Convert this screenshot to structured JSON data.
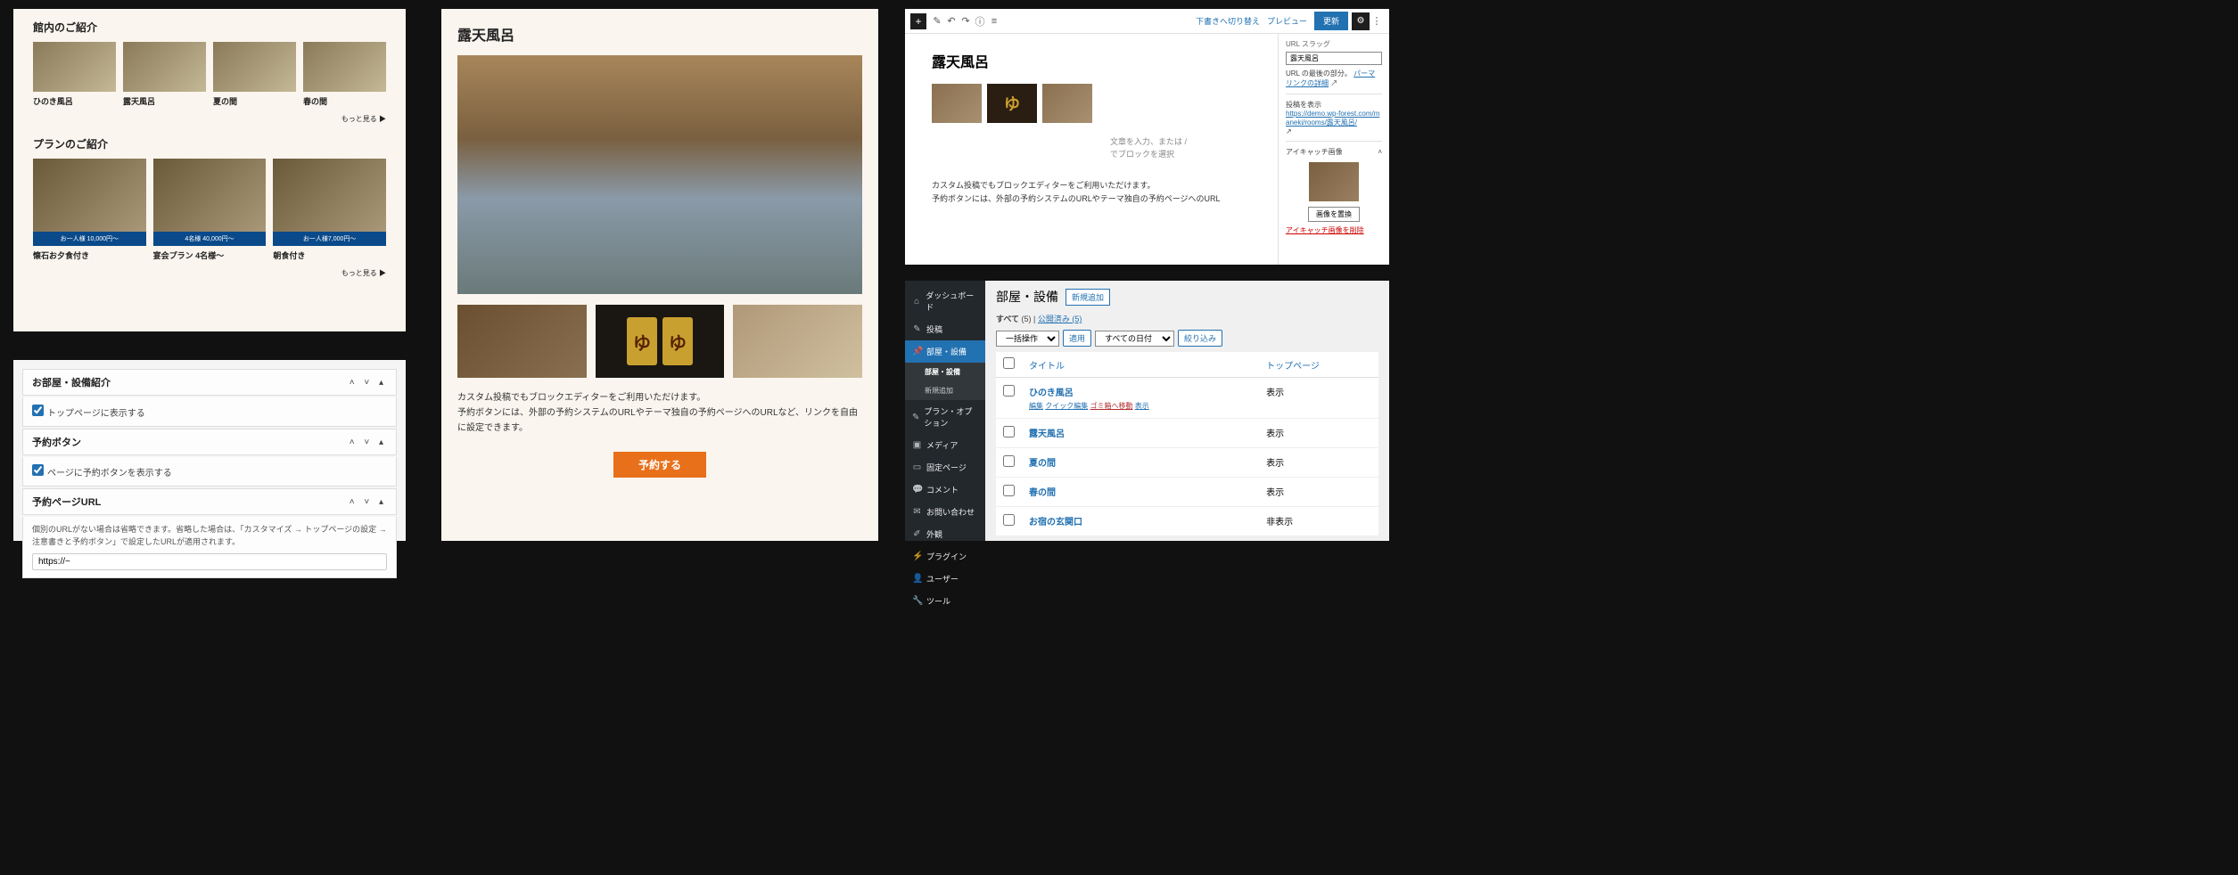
{
  "panel1": {
    "section1_title": "館内のご紹介",
    "rooms": [
      {
        "label": "ひのき風呂"
      },
      {
        "label": "露天風呂"
      },
      {
        "label": "夏の間"
      },
      {
        "label": "春の間"
      }
    ],
    "more": "もっと見る ▶",
    "section2_title": "プランのご紹介",
    "plans": [
      {
        "band": "お一人様 10,000円〜",
        "label": "懐石お夕食付き"
      },
      {
        "band": "4名様 40,000円〜",
        "label": "宴会プラン 4名様〜"
      },
      {
        "band": "お一人様7,000円〜",
        "label": "朝食付き"
      }
    ]
  },
  "panel2": {
    "h1": "お部屋・設備紹介",
    "chk1": "トップページに表示する",
    "h2": "予約ボタン",
    "chk2": "ページに予約ボタンを表示する",
    "h3": "予約ページURL",
    "note": "個別のURLがない場合は省略できます。省略した場合は、「カスタマイズ → トップページの設定 → 注意書きと予約ボタン」で設定したURLが適用されます。",
    "url_value": "https://~"
  },
  "panel3": {
    "title": "露天風呂",
    "body1": "カスタム投稿でもブロックエディターをご利用いただけます。",
    "body2": "予約ボタンには、外部の予約システムのURLやテーマ独自の予約ページへのURLなど、リンクを自由に設定できます。",
    "reserve": "予約する"
  },
  "panel4": {
    "top": {
      "draft": "下書きへ切り替え",
      "preview": "プレビュー",
      "update": "更新"
    },
    "title": "露天風呂",
    "placeholder": "文章を入力、または /\nでブロックを選択",
    "text1": "カスタム投稿でもブロックエディターをご利用いただけます。",
    "text2": "予約ボタンには、外部の予約システムのURLやテーマ独自の予約ページへのURL",
    "side": {
      "slug_label": "URL スラッグ",
      "slug_value": "露天風呂",
      "slug_note": "URL の最後の部分。",
      "slug_link": "パーマリンクの詳細",
      "view_post": "投稿を表示",
      "preview_url": "https://demo.wp-forest.com/maneki/rooms/露天風呂/",
      "eyecatch": "アイキャッチ画像",
      "replace": "画像を置換",
      "delete": "アイキャッチ画像を削除"
    }
  },
  "panel5": {
    "menu": [
      {
        "icon": "⌂",
        "label": "ダッシュボード"
      },
      {
        "icon": "✎",
        "label": "投稿"
      },
      {
        "icon": "📌",
        "label": "部屋・設備",
        "active": true,
        "sub": [
          "部屋・設備",
          "新規追加"
        ]
      },
      {
        "icon": "✎",
        "label": "プラン・オプション"
      },
      {
        "icon": "▣",
        "label": "メディア"
      },
      {
        "icon": "▭",
        "label": "固定ページ"
      },
      {
        "icon": "💬",
        "label": "コメント"
      },
      {
        "icon": "✉",
        "label": "お問い合わせ"
      },
      {
        "icon": "✐",
        "label": "外観"
      },
      {
        "icon": "⚡",
        "label": "プラグイン"
      },
      {
        "icon": "👤",
        "label": "ユーザー"
      },
      {
        "icon": "🔧",
        "label": "ツール"
      }
    ],
    "page_title": "部屋・設備",
    "add_new": "新規追加",
    "filter_all": "すべて",
    "filter_count": "(5)",
    "filter_pub": "公開済み (5)",
    "bulk": "一括操作",
    "apply": "適用",
    "all_dates": "すべての日付",
    "narrow": "絞り込み",
    "col_title": "タイトル",
    "col_top": "トップページ",
    "rows": [
      {
        "title": "ひのき風呂",
        "top": "表示",
        "actions": true
      },
      {
        "title": "露天風呂",
        "top": "表示"
      },
      {
        "title": "夏の間",
        "top": "表示"
      },
      {
        "title": "春の間",
        "top": "表示"
      },
      {
        "title": "お宿の玄関口",
        "top": "非表示"
      }
    ],
    "row_actions": {
      "edit": "編集",
      "quick": "クイック編集",
      "trash": "ゴミ箱へ移動",
      "view": "表示"
    }
  }
}
